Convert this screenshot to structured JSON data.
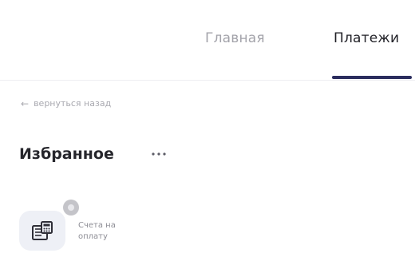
{
  "nav": {
    "tabs": [
      {
        "label": "Главная",
        "active": false
      },
      {
        "label": "Платежи",
        "active": true
      }
    ],
    "active_color": "#2b2d5e"
  },
  "back_link": {
    "label": "вернуться назад",
    "icon": "arrow-left-icon"
  },
  "favorites": {
    "title": "Избранное",
    "more_icon": "more-dots-icon",
    "items": [
      {
        "label_line1": "Счета на",
        "label_line2": "оплату",
        "icon": "invoice-calculator-icon"
      }
    ]
  }
}
